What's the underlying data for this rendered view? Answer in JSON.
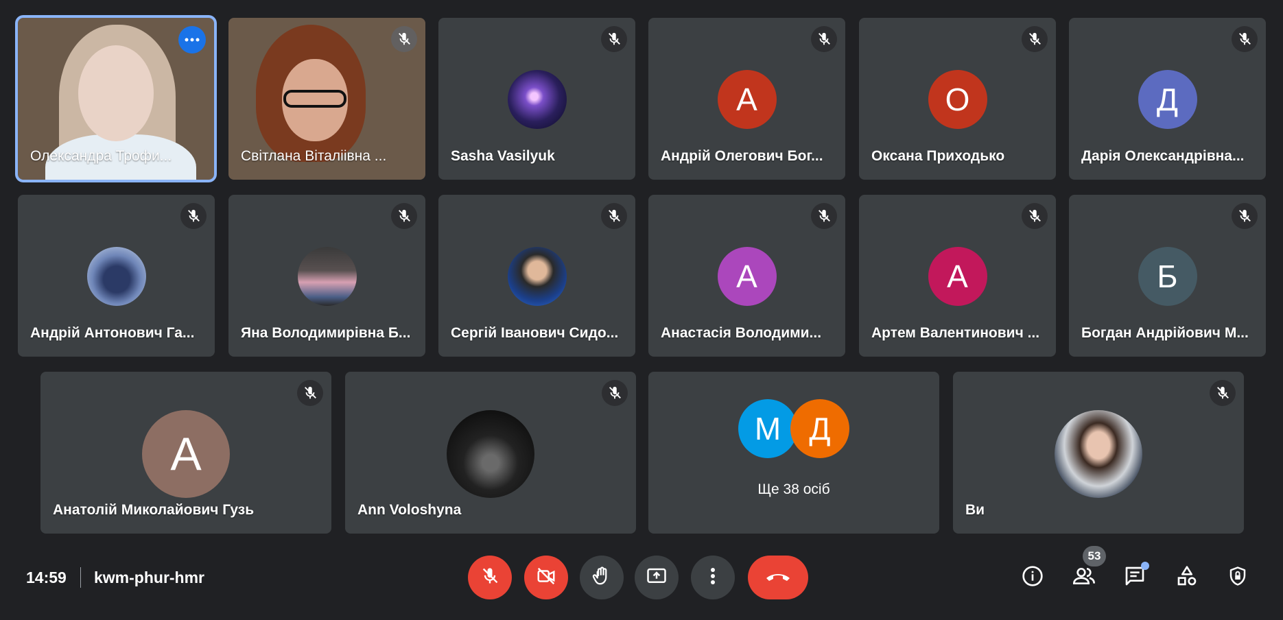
{
  "participants": [
    {
      "name": "Олександра Трофи...",
      "type": "video"
    },
    {
      "name": "Світлана Віталіівна ...",
      "type": "video"
    },
    {
      "name": "Sasha Vasilyuk",
      "type": "photo"
    },
    {
      "name": "Андрій Олегович Бог...",
      "initial": "А",
      "color": "#c1351d"
    },
    {
      "name": "Оксана Приходько",
      "initial": "О",
      "color": "#c1351d"
    },
    {
      "name": "Дарія Олександрівна...",
      "initial": "Д",
      "color": "#5c6bc0"
    },
    {
      "name": "Андрій Антонович Га...",
      "type": "photo"
    },
    {
      "name": "Яна Володимирівна Б...",
      "type": "photo"
    },
    {
      "name": "Сергій Іванович Сидо...",
      "type": "photo"
    },
    {
      "name": "Анастасія Володими...",
      "initial": "А",
      "color": "#ab47bc"
    },
    {
      "name": "Артем Валентинович ...",
      "initial": "А",
      "color": "#c2185b"
    },
    {
      "name": "Богдан Андрійович М...",
      "initial": "Б",
      "color": "#455a64"
    },
    {
      "name": "Анатолій Миколайович Гузь",
      "initial": "А",
      "color": "#8d6e63"
    },
    {
      "name": "Ann Voloshyna",
      "type": "photo"
    },
    {
      "name": "Ви",
      "type": "photo"
    }
  ],
  "more_tile": {
    "avatars": [
      {
        "initial": "М",
        "color": "#039be5"
      },
      {
        "initial": "Д",
        "color": "#ef6c00"
      }
    ],
    "label": "Ще 38 осіб"
  },
  "bottom_bar": {
    "time": "14:59",
    "meeting_code": "kwm-phur-hmr",
    "participant_count": "53"
  },
  "icons": {
    "mic_off": "mic-off-icon",
    "cam_off": "videocam-off-icon",
    "hand": "raise-hand-icon",
    "present": "present-screen-icon",
    "more": "more-vert-icon",
    "end_call": "call-end-icon",
    "info": "info-icon",
    "people": "people-icon",
    "chat": "chat-icon",
    "activities": "activities-icon",
    "host": "host-controls-icon"
  },
  "colors": {
    "background": "#202124",
    "tile": "#3c4043",
    "danger": "#ea4335",
    "accent": "#8ab4f8"
  }
}
